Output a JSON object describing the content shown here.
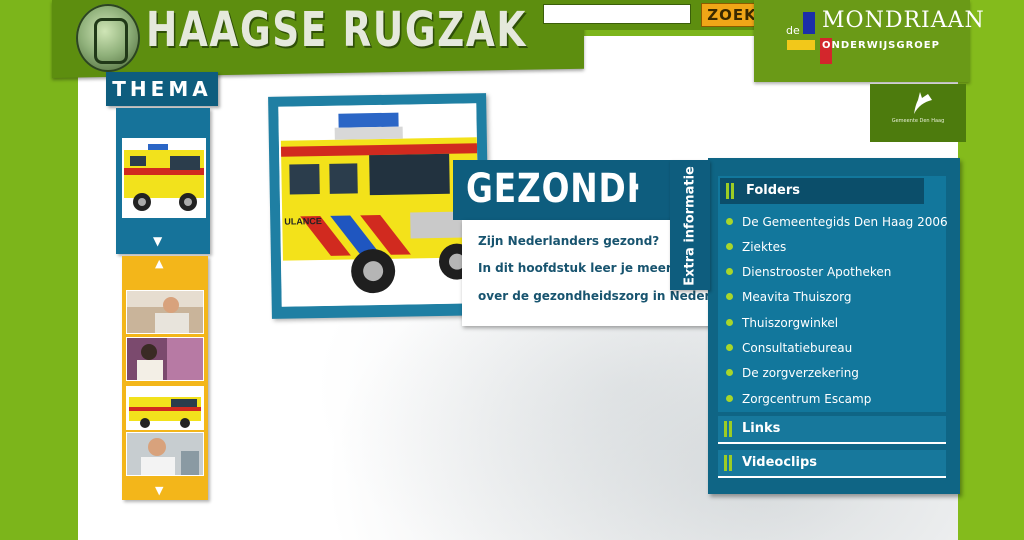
{
  "header": {
    "site_title": "HAAGSE RUGZAK",
    "search_placeholder": "",
    "search_button": "ZOEK",
    "partner": {
      "prefix": "de",
      "name": "MONDRIAAN",
      "subtitle": "ONDERWIJSGROEP"
    },
    "municipality": "Gemeente Den Haag"
  },
  "sidebar": {
    "tab_label": "THEMA"
  },
  "article": {
    "title": "GEZONDHEID",
    "lines": [
      "Zijn Nederlanders gezond?",
      "In dit hoofdstuk leer je meer",
      "over de gezondheidszorg in Nederland."
    ],
    "vehicle_text": "ULANCE"
  },
  "extra": {
    "tab_label": "Extra informatie",
    "sections": {
      "folders": "Folders",
      "links": "Links",
      "videoclips": "Videoclips"
    },
    "folder_items": [
      "De Gemeentegids Den Haag 2006",
      "Ziektes",
      "Dienstrooster Apotheken",
      "Meavita Thuiszorg",
      "Thuiszorgwinkel",
      "Consultatiebureau",
      "De zorgverzekering",
      "Zorgcentrum Escamp"
    ]
  },
  "colors": {
    "lime": "#7cb51b",
    "teal": "#0e5d7e",
    "yellow": "#f3b61a",
    "bullet": "#a8d62a"
  }
}
